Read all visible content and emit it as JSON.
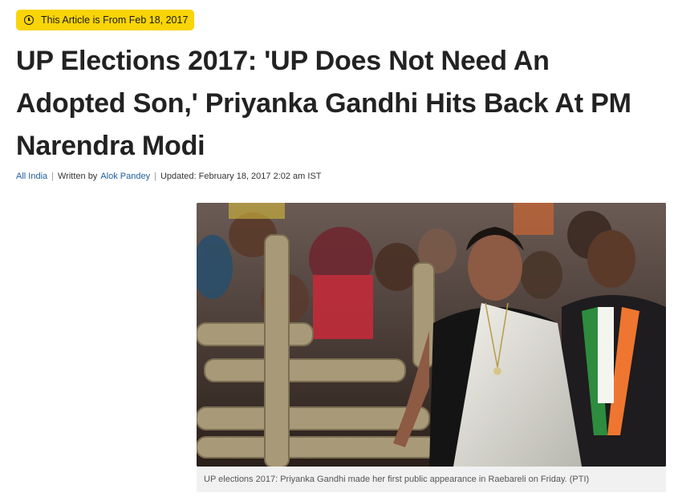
{
  "badge": {
    "icon": "clock-icon",
    "text": "This Article is From Feb 18, 2017",
    "color": "#f9d407"
  },
  "article": {
    "headline_lines": [
      "UP Elections 2017: 'UP Does Not Need An",
      "Adopted Son,' Priyanka Gandhi Hits Back At PM",
      "Narendra Modi"
    ],
    "byline": {
      "category": "All India",
      "written_by_prefix": "Written by",
      "author": "Alok Pandey",
      "updated": "Updated: February 18, 2017 2:02 am IST"
    },
    "image": {
      "caption": "UP elections 2017: Priyanka Gandhi made her first public appearance in Raebareli on Friday. (PTI)"
    }
  },
  "colors": {
    "link": "#1f5e9a",
    "headline": "#222222",
    "caption_bg": "#f1f1f1"
  }
}
